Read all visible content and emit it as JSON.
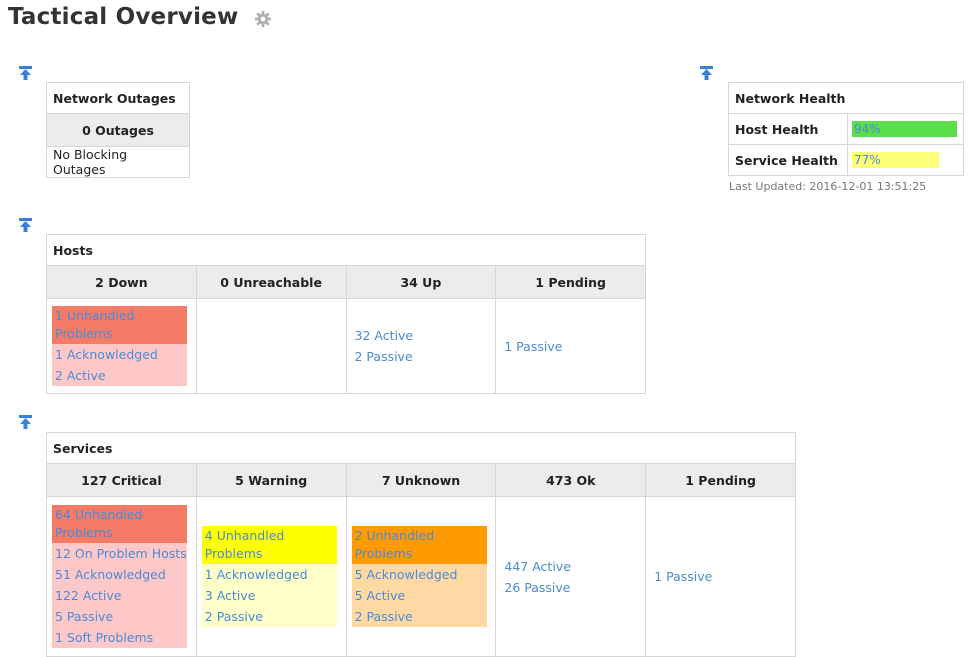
{
  "page": {
    "title": "Tactical Overview"
  },
  "outages": {
    "header": "Network Outages",
    "count_label": "0 Outages",
    "blocking": "No Blocking Outages"
  },
  "health": {
    "header": "Network Health",
    "host_label": "Host Health",
    "host_value": "94%",
    "host_fraction": 0.94,
    "service_label": "Service Health",
    "service_value": "77%",
    "service_fraction": 0.77,
    "last_updated": "Last Updated: 2016-12-01 13:51:25"
  },
  "hosts": {
    "header": "Hosts",
    "columns": [
      "2 Down",
      "0 Unreachable",
      "34 Up",
      "1 Pending"
    ],
    "down": {
      "unhandled": "1 Unhandled Problems",
      "ack": "1 Acknowledged",
      "active": "2 Active"
    },
    "up": {
      "active": "32 Active",
      "passive": "2 Passive"
    },
    "pending": {
      "passive": "1 Passive"
    }
  },
  "services": {
    "header": "Services",
    "columns": [
      "127 Critical",
      "5 Warning",
      "7 Unknown",
      "473 Ok",
      "1 Pending"
    ],
    "critical": {
      "unhandled": "64 Unhandled Problems",
      "on_problem_hosts": "12 On Problem Hosts",
      "ack": "51 Acknowledged",
      "active": "122 Active",
      "passive": "5 Passive",
      "soft": "1 Soft Problems"
    },
    "warning": {
      "unhandled": "4 Unhandled Problems",
      "ack": "1 Acknowledged",
      "active": "3 Active",
      "passive": "2 Passive"
    },
    "unknown": {
      "unhandled": "2 Unhandled Problems",
      "ack": "5 Acknowledged",
      "active": "5 Active",
      "passive": "2 Passive"
    },
    "ok": {
      "active": "447 Active",
      "passive": "26 Passive"
    },
    "pending": {
      "passive": "1 Passive"
    }
  },
  "colors": {
    "critical_dark": "#f47c66",
    "critical_light": "#ffc8c8",
    "warning_dark": "#ffff00",
    "warning_light": "#fefec8",
    "unknown_dark": "#ff9a00",
    "unknown_light": "#fed9a4",
    "health_green": "#5adf4a",
    "health_yellow": "#ffff7a",
    "link": "#4a8ad6"
  }
}
